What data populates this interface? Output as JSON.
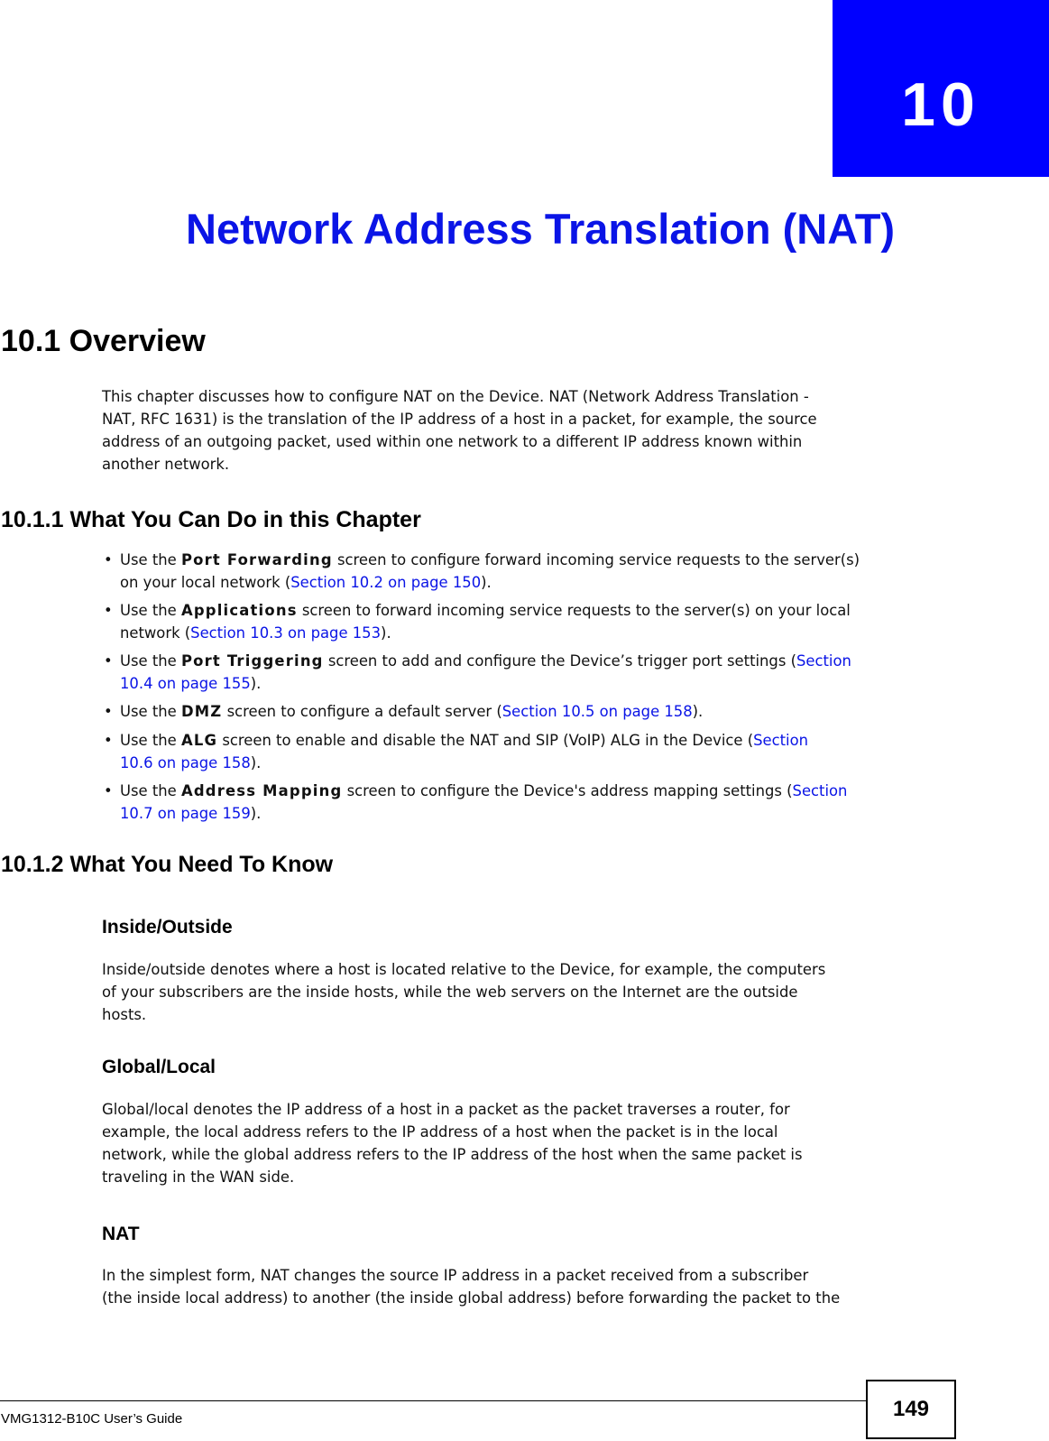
{
  "chapter": {
    "number": "10",
    "title": "Network Address Translation (NAT)"
  },
  "colors": {
    "accent": "#0000ff",
    "link": "#0a14e6",
    "text": "#111111"
  },
  "overview": {
    "heading": "10.1  Overview",
    "lines": [
      "This chapter discusses how to configure NAT on the Device. NAT (Network Address Translation -",
      "NAT, RFC 1631) is the translation of the IP address of a host in a packet, for example, the source",
      "address of an outgoing packet, used within one network to a different IP address known within",
      "another network."
    ]
  },
  "what_you_can_do": {
    "heading": "10.1.1  What You Can Do in this Chapter",
    "bullets": [
      {
        "lines": [
          {
            "pre": "Use the ",
            "bold": "Port Forwarding",
            "post": " screen to configure forward incoming service requests to the server(s)"
          },
          {
            "pre": "on your local network (",
            "link": "Section 10.2 on page 150",
            "post": ")."
          }
        ]
      },
      {
        "lines": [
          {
            "pre": "Use the ",
            "bold": "Applications",
            "post": " screen to forward incoming service requests to the server(s) on your local"
          },
          {
            "pre": "network (",
            "link": "Section 10.3 on page 153",
            "post": ")."
          }
        ]
      },
      {
        "lines": [
          {
            "pre": "Use the ",
            "bold": "Port Triggering",
            "post": " screen to add and configure the Device’s trigger port settings (",
            "link": "Section"
          },
          {
            "pre": "",
            "link": "10.4 on page 155",
            "post": ")."
          }
        ]
      },
      {
        "lines": [
          {
            "pre": "Use the ",
            "bold": "DMZ",
            "post": " screen to configure a default server (",
            "link": "Section 10.5 on page 158",
            "post2": ")."
          }
        ]
      },
      {
        "lines": [
          {
            "pre": "Use the ",
            "bold": "ALG",
            "post": " screen to enable and disable the NAT and SIP (VoIP) ALG in the Device (",
            "link": "Section"
          },
          {
            "pre": "",
            "link": "10.6 on page 158",
            "post": ")."
          }
        ]
      },
      {
        "lines": [
          {
            "pre": "Use the ",
            "bold": "Address Mapping",
            "post": " screen to configure the Device's address mapping settings (",
            "link": "Section"
          },
          {
            "pre": "",
            "link": "10.7 on page 159",
            "post": ")."
          }
        ]
      }
    ]
  },
  "what_you_need": {
    "heading": "10.1.2  What You Need To Know",
    "sections": [
      {
        "title": "Inside/Outside",
        "lines": [
          "Inside/outside denotes where a host is located relative to the Device, for example, the computers",
          "of your subscribers are the inside hosts, while the web servers on the Internet are the outside",
          "hosts."
        ]
      },
      {
        "title": "Global/Local",
        "lines": [
          "Global/local denotes the IP address of a host in a packet as the packet traverses a router, for",
          "example, the local address refers to the IP address of a host when the packet is in the local",
          "network, while the global address refers to the IP address of the host when the same packet is",
          "traveling in the WAN side."
        ]
      },
      {
        "title": "NAT",
        "lines": [
          "In the simplest form, NAT changes the source IP address in a packet received from a subscriber",
          "(the inside local address) to another (the inside global address) before forwarding the packet to the"
        ]
      }
    ]
  },
  "footer": {
    "guide": "VMG1312-B10C User’s Guide",
    "page": "149"
  },
  "bullet_glyph": "•"
}
